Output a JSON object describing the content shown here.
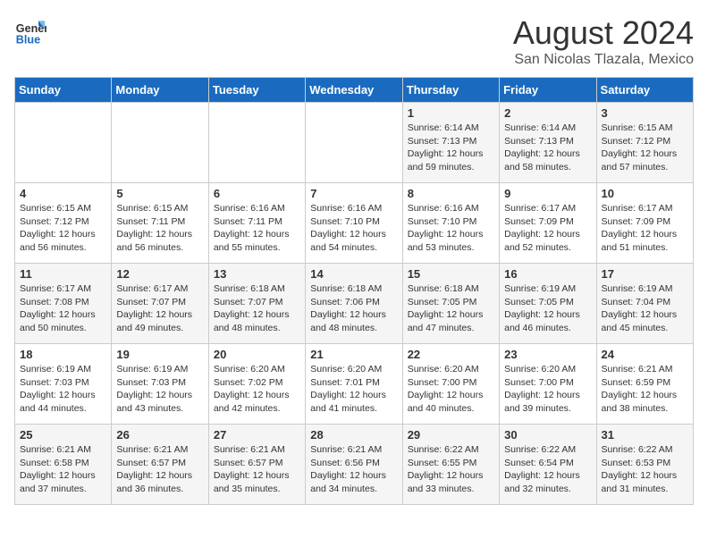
{
  "header": {
    "logo_line1": "General",
    "logo_line2": "Blue",
    "title": "August 2024",
    "subtitle": "San Nicolas Tlazala, Mexico"
  },
  "days_of_week": [
    "Sunday",
    "Monday",
    "Tuesday",
    "Wednesday",
    "Thursday",
    "Friday",
    "Saturday"
  ],
  "weeks": [
    [
      {
        "day": "",
        "info": ""
      },
      {
        "day": "",
        "info": ""
      },
      {
        "day": "",
        "info": ""
      },
      {
        "day": "",
        "info": ""
      },
      {
        "day": "1",
        "info": "Sunrise: 6:14 AM\nSunset: 7:13 PM\nDaylight: 12 hours\nand 59 minutes."
      },
      {
        "day": "2",
        "info": "Sunrise: 6:14 AM\nSunset: 7:13 PM\nDaylight: 12 hours\nand 58 minutes."
      },
      {
        "day": "3",
        "info": "Sunrise: 6:15 AM\nSunset: 7:12 PM\nDaylight: 12 hours\nand 57 minutes."
      }
    ],
    [
      {
        "day": "4",
        "info": "Sunrise: 6:15 AM\nSunset: 7:12 PM\nDaylight: 12 hours\nand 56 minutes."
      },
      {
        "day": "5",
        "info": "Sunrise: 6:15 AM\nSunset: 7:11 PM\nDaylight: 12 hours\nand 56 minutes."
      },
      {
        "day": "6",
        "info": "Sunrise: 6:16 AM\nSunset: 7:11 PM\nDaylight: 12 hours\nand 55 minutes."
      },
      {
        "day": "7",
        "info": "Sunrise: 6:16 AM\nSunset: 7:10 PM\nDaylight: 12 hours\nand 54 minutes."
      },
      {
        "day": "8",
        "info": "Sunrise: 6:16 AM\nSunset: 7:10 PM\nDaylight: 12 hours\nand 53 minutes."
      },
      {
        "day": "9",
        "info": "Sunrise: 6:17 AM\nSunset: 7:09 PM\nDaylight: 12 hours\nand 52 minutes."
      },
      {
        "day": "10",
        "info": "Sunrise: 6:17 AM\nSunset: 7:09 PM\nDaylight: 12 hours\nand 51 minutes."
      }
    ],
    [
      {
        "day": "11",
        "info": "Sunrise: 6:17 AM\nSunset: 7:08 PM\nDaylight: 12 hours\nand 50 minutes."
      },
      {
        "day": "12",
        "info": "Sunrise: 6:17 AM\nSunset: 7:07 PM\nDaylight: 12 hours\nand 49 minutes."
      },
      {
        "day": "13",
        "info": "Sunrise: 6:18 AM\nSunset: 7:07 PM\nDaylight: 12 hours\nand 48 minutes."
      },
      {
        "day": "14",
        "info": "Sunrise: 6:18 AM\nSunset: 7:06 PM\nDaylight: 12 hours\nand 48 minutes."
      },
      {
        "day": "15",
        "info": "Sunrise: 6:18 AM\nSunset: 7:05 PM\nDaylight: 12 hours\nand 47 minutes."
      },
      {
        "day": "16",
        "info": "Sunrise: 6:19 AM\nSunset: 7:05 PM\nDaylight: 12 hours\nand 46 minutes."
      },
      {
        "day": "17",
        "info": "Sunrise: 6:19 AM\nSunset: 7:04 PM\nDaylight: 12 hours\nand 45 minutes."
      }
    ],
    [
      {
        "day": "18",
        "info": "Sunrise: 6:19 AM\nSunset: 7:03 PM\nDaylight: 12 hours\nand 44 minutes."
      },
      {
        "day": "19",
        "info": "Sunrise: 6:19 AM\nSunset: 7:03 PM\nDaylight: 12 hours\nand 43 minutes."
      },
      {
        "day": "20",
        "info": "Sunrise: 6:20 AM\nSunset: 7:02 PM\nDaylight: 12 hours\nand 42 minutes."
      },
      {
        "day": "21",
        "info": "Sunrise: 6:20 AM\nSunset: 7:01 PM\nDaylight: 12 hours\nand 41 minutes."
      },
      {
        "day": "22",
        "info": "Sunrise: 6:20 AM\nSunset: 7:00 PM\nDaylight: 12 hours\nand 40 minutes."
      },
      {
        "day": "23",
        "info": "Sunrise: 6:20 AM\nSunset: 7:00 PM\nDaylight: 12 hours\nand 39 minutes."
      },
      {
        "day": "24",
        "info": "Sunrise: 6:21 AM\nSunset: 6:59 PM\nDaylight: 12 hours\nand 38 minutes."
      }
    ],
    [
      {
        "day": "25",
        "info": "Sunrise: 6:21 AM\nSunset: 6:58 PM\nDaylight: 12 hours\nand 37 minutes."
      },
      {
        "day": "26",
        "info": "Sunrise: 6:21 AM\nSunset: 6:57 PM\nDaylight: 12 hours\nand 36 minutes."
      },
      {
        "day": "27",
        "info": "Sunrise: 6:21 AM\nSunset: 6:57 PM\nDaylight: 12 hours\nand 35 minutes."
      },
      {
        "day": "28",
        "info": "Sunrise: 6:21 AM\nSunset: 6:56 PM\nDaylight: 12 hours\nand 34 minutes."
      },
      {
        "day": "29",
        "info": "Sunrise: 6:22 AM\nSunset: 6:55 PM\nDaylight: 12 hours\nand 33 minutes."
      },
      {
        "day": "30",
        "info": "Sunrise: 6:22 AM\nSunset: 6:54 PM\nDaylight: 12 hours\nand 32 minutes."
      },
      {
        "day": "31",
        "info": "Sunrise: 6:22 AM\nSunset: 6:53 PM\nDaylight: 12 hours\nand 31 minutes."
      }
    ]
  ]
}
